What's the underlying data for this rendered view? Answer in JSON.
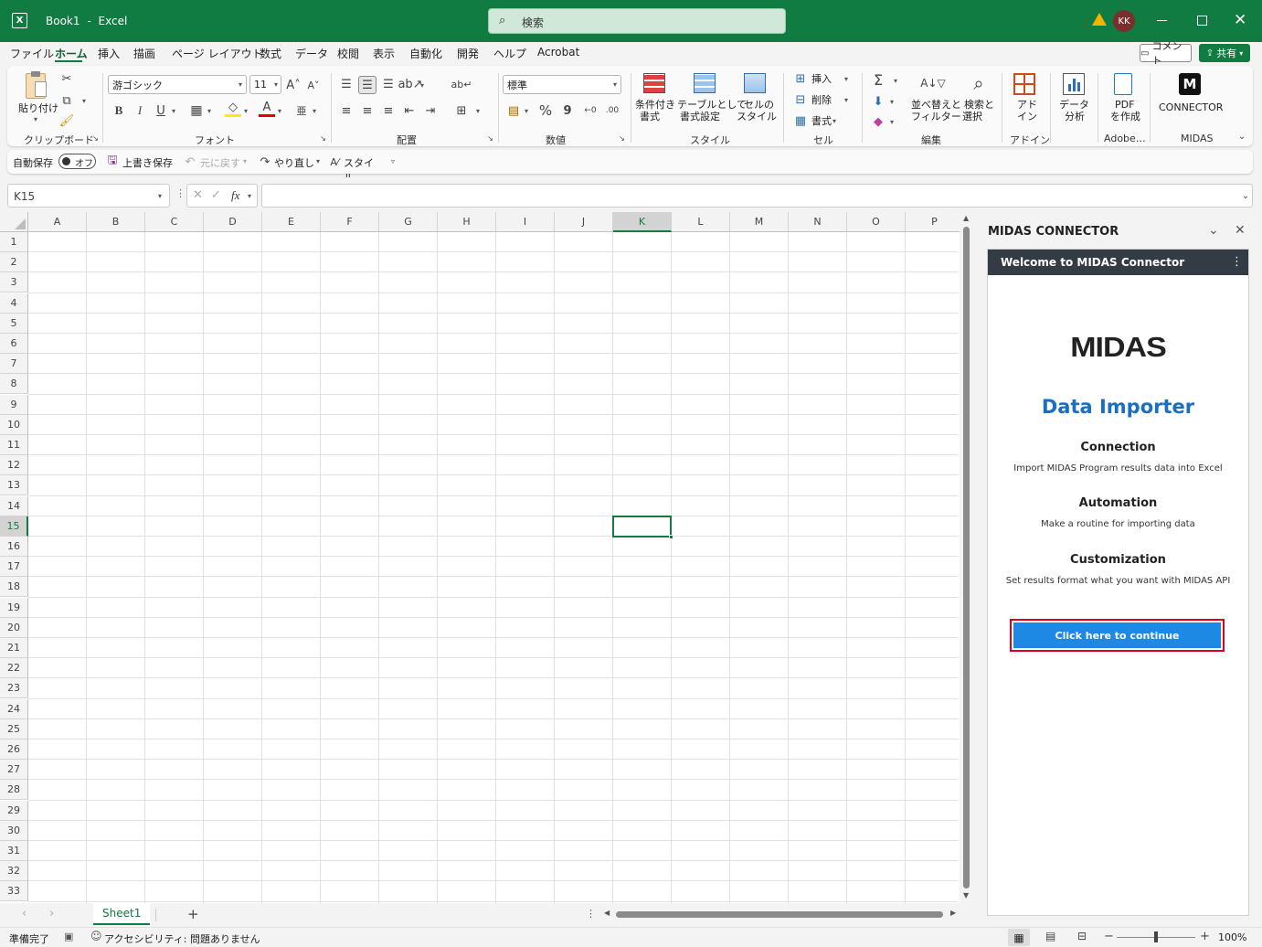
{
  "app": {
    "file_name": "Book1",
    "separator": "-",
    "app_name": "Excel",
    "search_placeholder": "検索",
    "user_initials": "KK"
  },
  "menu": {
    "tabs": [
      "ファイル",
      "ホーム",
      "挿入",
      "描画",
      "ページ レイアウト",
      "数式",
      "データ",
      "校閲",
      "表示",
      "自動化",
      "開発",
      "ヘルプ",
      "Acrobat"
    ],
    "active_tab": "ホーム",
    "comment_label": "コメント",
    "share_label": "共有"
  },
  "ribbon": {
    "clipboard": {
      "paste_label": "貼り付け",
      "group_label": "クリップボード"
    },
    "font": {
      "font_name": "游ゴシック",
      "font_size": "11",
      "bold": "B",
      "italic": "I",
      "underline": "U",
      "group_label": "フォント"
    },
    "alignment": {
      "group_label": "配置"
    },
    "number": {
      "format": "標準",
      "percent": "%",
      "comma": "9",
      "group_label": "数値"
    },
    "styles": {
      "conditional": [
        "条件付き",
        "書式"
      ],
      "table": [
        "テーブルとして",
        "書式設定"
      ],
      "cell_style": [
        "セルの",
        "スタイル"
      ],
      "group_label": "スタイル"
    },
    "cells": {
      "insert": "挿入",
      "delete": "削除",
      "format": "書式",
      "group_label": "セル"
    },
    "editing": {
      "sort": [
        "並べ替えと",
        "フィルター"
      ],
      "find": [
        "検索と",
        "選択"
      ],
      "group_label": "編集"
    },
    "addins": {
      "addin": [
        "アド",
        "イン"
      ],
      "group_label": "アドイン"
    },
    "analysis": {
      "label": [
        "データ",
        "分析"
      ]
    },
    "adobe": {
      "label": [
        "PDF",
        "を作成"
      ],
      "group_label": "Adobe…"
    },
    "midas": {
      "label": "CONNECTOR",
      "group_label": "MIDAS"
    }
  },
  "qat": {
    "autosave_label": "自動保存",
    "autosave_state": "オフ",
    "save_label": "上書き保存",
    "undo_label": "元に戻す",
    "redo_label": "やり直し",
    "style_label": "スタイル"
  },
  "formula_bar": {
    "name_box": "K15",
    "fx": "fx",
    "value": ""
  },
  "grid": {
    "columns": [
      "A",
      "B",
      "C",
      "D",
      "E",
      "F",
      "G",
      "H",
      "I",
      "J",
      "K",
      "L",
      "M",
      "N",
      "O",
      "P"
    ],
    "rows": [
      "1",
      "2",
      "3",
      "4",
      "5",
      "6",
      "7",
      "8",
      "9",
      "10",
      "11",
      "12",
      "13",
      "14",
      "15",
      "16",
      "17",
      "18",
      "19",
      "20",
      "21",
      "22",
      "23",
      "24",
      "25",
      "26",
      "27",
      "28",
      "29",
      "30",
      "31",
      "32",
      "33"
    ],
    "selected_cell": "K15",
    "selected_column": "K",
    "selected_row": "15"
  },
  "sheets": {
    "tabs": [
      "Sheet1"
    ],
    "add_label": "+"
  },
  "status": {
    "ready": "準備完了",
    "accessibility": "アクセシビリティ: 問題ありません",
    "zoom": "100%",
    "zoom_minus": "−",
    "zoom_plus": "+"
  },
  "task_pane": {
    "title": "MIDAS CONNECTOR",
    "header": "Welcome to MIDAS Connector",
    "logo_text": "MIDAS",
    "heading": "Data Importer",
    "sections": [
      {
        "title": "Connection",
        "desc": "Import MIDAS Program results data into Excel"
      },
      {
        "title": "Automation",
        "desc": "Make a routine for importing data"
      },
      {
        "title": "Customization",
        "desc": "Set results format what you want with MIDAS API"
      }
    ],
    "button_label": "Click here to continue"
  },
  "colors": {
    "excel_green": "#107c41",
    "accent_blue": "#1e88e5",
    "heading_blue": "#1b6fc2",
    "highlight_red": "#e0001b"
  }
}
